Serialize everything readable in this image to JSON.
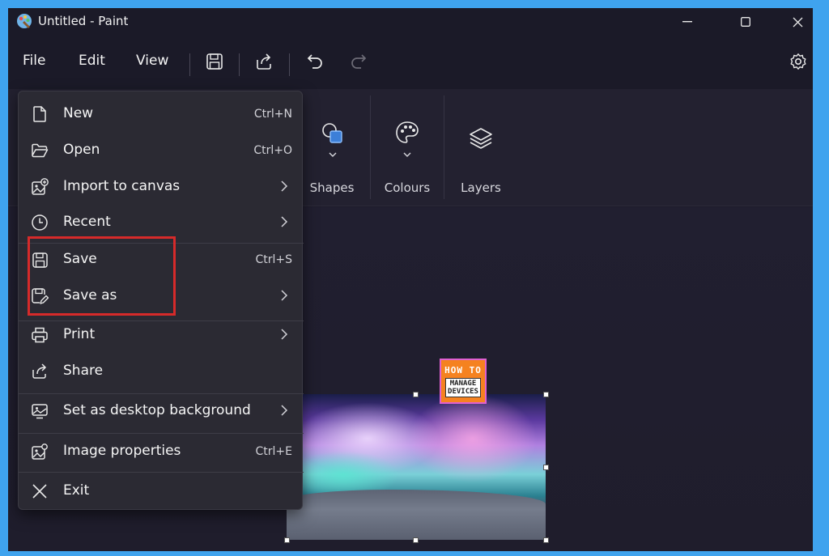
{
  "window": {
    "title": "Untitled - Paint"
  },
  "menubar": {
    "file": "File",
    "edit": "Edit",
    "view": "View"
  },
  "toolbar": {
    "icons": [
      "save-icon",
      "share-icon",
      "undo-icon",
      "redo-icon",
      "settings-icon"
    ]
  },
  "ribbon": {
    "groups": [
      {
        "label": "Shapes"
      },
      {
        "label": "Colours"
      },
      {
        "label": "Layers"
      }
    ]
  },
  "file_menu": {
    "items": [
      {
        "label": "New",
        "shortcut": "Ctrl+N"
      },
      {
        "label": "Open",
        "shortcut": "Ctrl+O"
      },
      {
        "label": "Import to canvas",
        "shortcut": ""
      },
      {
        "label": "Recent",
        "shortcut": ""
      },
      {
        "label": "Save",
        "shortcut": "Ctrl+S"
      },
      {
        "label": "Save as",
        "shortcut": ""
      },
      {
        "label": "Print",
        "shortcut": ""
      },
      {
        "label": "Share",
        "shortcut": ""
      },
      {
        "label": "Set as desktop background",
        "shortcut": ""
      },
      {
        "label": "Image properties",
        "shortcut": "Ctrl+E"
      },
      {
        "label": "Exit",
        "shortcut": ""
      }
    ]
  },
  "watermark": {
    "line1": "HOW TO",
    "line2": "MANAGE",
    "line3": "DEVICES"
  },
  "colors": {
    "accent_frame": "#3fa3ee",
    "highlight_box": "#d62a2a",
    "menu_bg": "#2b2a33"
  }
}
